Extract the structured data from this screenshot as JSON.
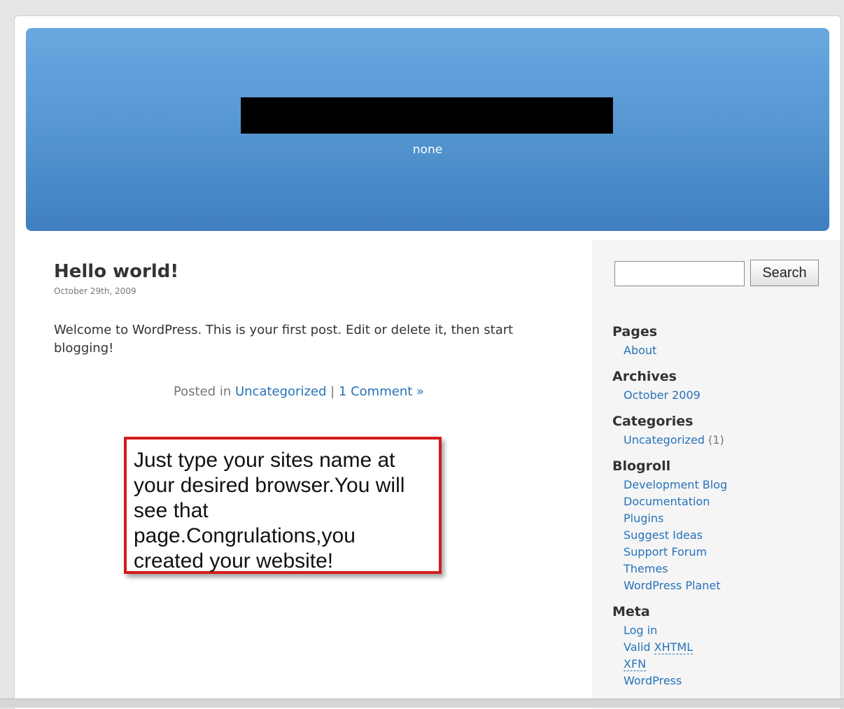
{
  "header": {
    "blog_description": "none"
  },
  "post": {
    "title": "Hello world!",
    "date": "October 29th, 2009",
    "body": "Welcome to WordPress. This is your first post. Edit or delete it, then start blogging!",
    "meta_prefix": "Posted in ",
    "category_link": "Uncategorized",
    "separator": " | ",
    "comments_link": "1 Comment »"
  },
  "callout": {
    "lines": [
      "Just type your sites name at",
      "your desired browser.You will",
      "see that",
      "page.Congrulations,you",
      "created your website!"
    ],
    "border_color": "#d21b1b"
  },
  "sidebar": {
    "search": {
      "button_label": "Search",
      "value": ""
    },
    "pages": {
      "title": "Pages",
      "items": [
        "About"
      ]
    },
    "archives": {
      "title": "Archives",
      "items": [
        "October 2009"
      ]
    },
    "categories": {
      "title": "Categories",
      "items": [
        {
          "label": "Uncategorized",
          "count": "(1)"
        }
      ]
    },
    "blogroll": {
      "title": "Blogroll",
      "items": [
        "Development Blog",
        "Documentation",
        "Plugins",
        "Suggest Ideas",
        "Support Forum",
        "Themes",
        "WordPress Planet"
      ]
    },
    "meta": {
      "title": "Meta",
      "log_in": "Log in",
      "valid_prefix": "Valid ",
      "xhtml": "XHTML",
      "xfn": "XFN",
      "wordpress": "WordPress"
    }
  },
  "colors": {
    "header_top": "#69a8e0",
    "header_bottom": "#3f7fbf",
    "link": "#2672b8"
  }
}
